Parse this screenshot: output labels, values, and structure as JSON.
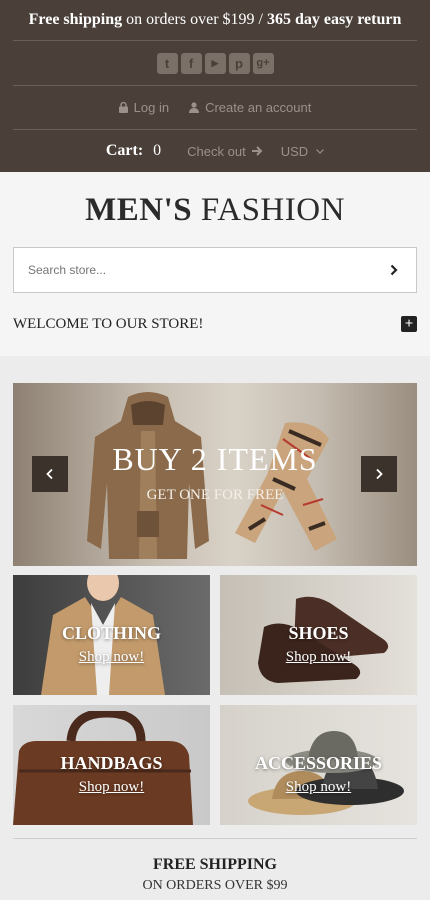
{
  "topbar": {
    "promo_bold_1": "Free shipping",
    "promo_mid": " on orders over $199 / ",
    "promo_bold_2": "365 day easy return",
    "social": [
      {
        "icon": "twitter-icon",
        "glyph": "t"
      },
      {
        "icon": "facebook-icon",
        "glyph": "f"
      },
      {
        "icon": "youtube-icon",
        "glyph": "▶"
      },
      {
        "icon": "pinterest-icon",
        "glyph": "p"
      },
      {
        "icon": "google-plus-icon",
        "glyph": "g+"
      }
    ],
    "login_label": "Log in",
    "create_account_label": "Create an account",
    "cart_label": "Cart:",
    "cart_count": "0",
    "checkout_label": "Check out",
    "currency": "USD"
  },
  "header": {
    "logo_bold": "MEN'S",
    "logo_light": " FASHION",
    "search_placeholder": "Search store...",
    "welcome": "WELCOME TO OUR STORE!"
  },
  "slider": {
    "title": "BUY 2 ITEMS",
    "subtitle": "GET ONE FOR FREE"
  },
  "categories": [
    {
      "title": "CLOTHING",
      "link": "Shop now!"
    },
    {
      "title": "SHOES",
      "link": "Shop now!"
    },
    {
      "title": "HANDBAGS",
      "link": "Shop now!"
    },
    {
      "title": "ACCESSORIES",
      "link": "Shop now!"
    }
  ],
  "shipping": {
    "title": "FREE SHIPPING",
    "subtitle": "ON ORDERS OVER $99"
  },
  "colors": {
    "topbar_bg": "#4a4039",
    "header_bg": "#f5f5f5",
    "page_bg": "#ececec"
  }
}
